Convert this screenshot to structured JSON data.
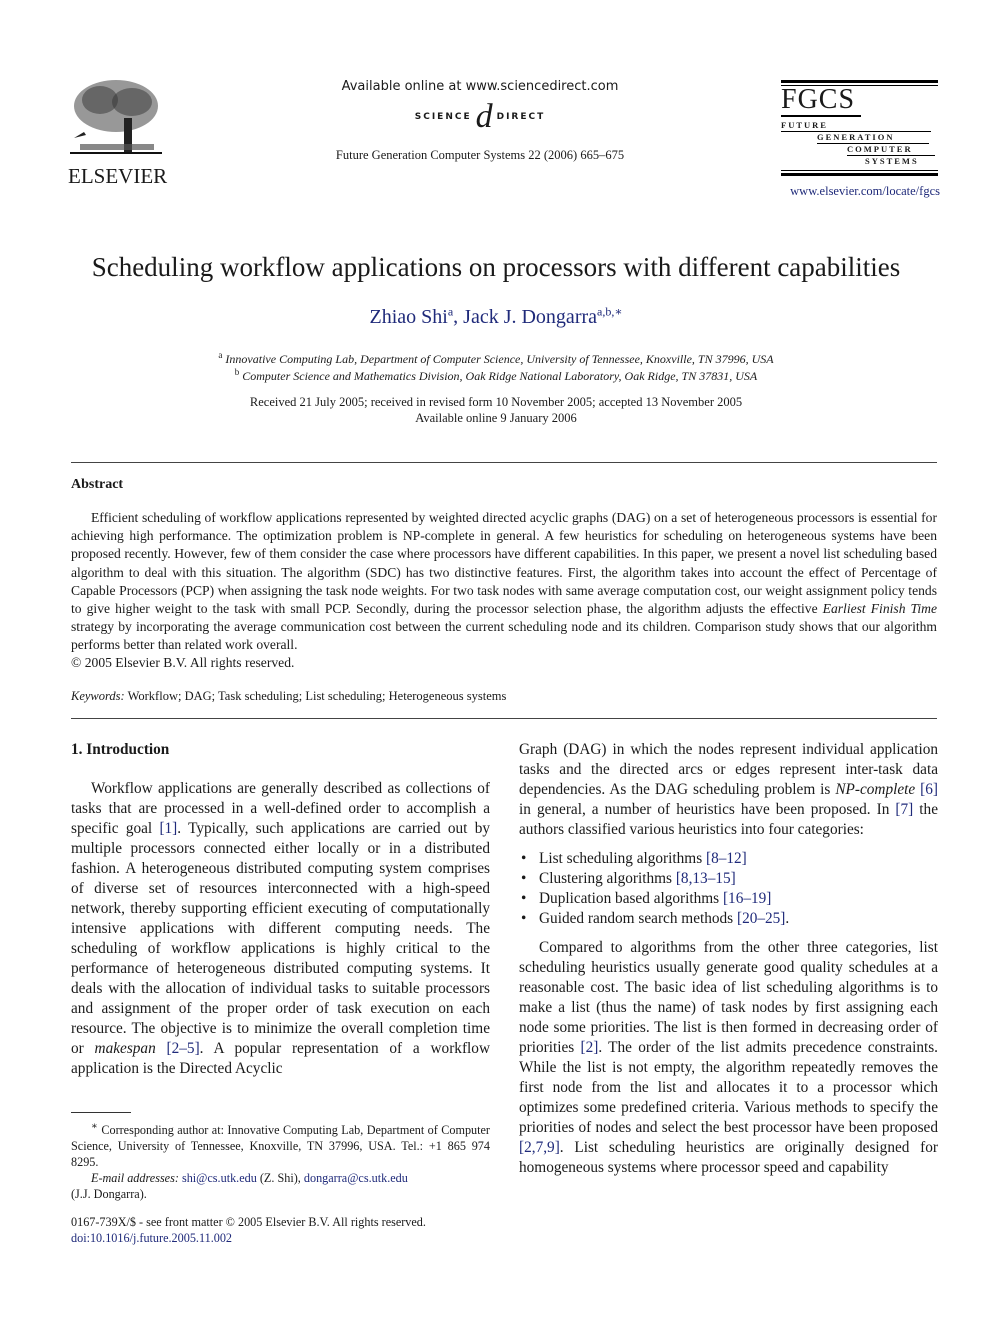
{
  "header": {
    "publisher_name": "ELSEVIER",
    "available_online": "Available online at www.sciencedirect.com",
    "sd_left": "SCIENCE",
    "sd_at": "d",
    "sd_right": "DIRECT",
    "journal_citation": "Future Generation Computer Systems 22 (2006) 665–675",
    "fgcs": {
      "title": "FGCS",
      "lines": [
        "FUTURE",
        "GENERATION",
        "COMPUTER",
        "SYSTEMS"
      ]
    },
    "journal_url": "www.elsevier.com/locate/fgcs"
  },
  "paper": {
    "title": "Scheduling workflow applications on processors with different capabilities",
    "authors": [
      {
        "name": "Zhiao Shi",
        "sup": "a"
      },
      {
        "name": "Jack J. Dongarra",
        "sup": "a,b,∗"
      }
    ],
    "author_separator": ", ",
    "affiliations": [
      {
        "sup": "a",
        "text": "Innovative Computing Lab, Department of Computer Science, University of Tennessee, Knoxville, TN 37996, USA"
      },
      {
        "sup": "b",
        "text": "Computer Science and Mathematics Division, Oak Ridge National Laboratory, Oak Ridge, TN 37831, USA"
      }
    ],
    "received": "Received 21 July 2005; received in revised form 10 November 2005; accepted 13 November 2005",
    "available": "Available online 9 January 2006"
  },
  "abstract": {
    "heading": "Abstract",
    "text_a": "Efficient scheduling of workflow applications represented by weighted directed acyclic graphs (DAG) on a set of heterogeneous processors is essential for achieving high performance. The optimization problem is NP-complete in general. A few heuristics for scheduling on heterogeneous systems have been proposed recently. However, few of them consider the case where processors have different capabilities. In this paper, we present a novel list scheduling based algorithm to deal with this situation. The algorithm (SDC) has two distinctive features. First, the algorithm takes into account the effect of Percentage of Capable Processors (PCP) when assigning the task node weights. For two task nodes with same average computation cost, our weight assignment policy tends to give higher weight to the task with small PCP. Secondly, during the processor selection phase, the algorithm adjusts the effective ",
    "text_italic": "Earliest Finish Time",
    "text_b": " strategy by incorporating the average communication cost between the current scheduling node and its children. Comparison study shows that our algorithm performs better than related work overall.",
    "copyright": "© 2005 Elsevier B.V. All rights reserved.",
    "keywords_label": "Keywords:",
    "keywords": " Workflow; DAG; Task scheduling; List scheduling; Heterogeneous systems"
  },
  "intro": {
    "heading": "1.  Introduction",
    "p1_a": "Workflow applications are generally described as collections of tasks that are processed in a well-defined order to accomplish a specific goal ",
    "p1_ref1": "[1]",
    "p1_b": ". Typically, such applications are carried out by multiple processors connected either locally or in a distributed fashion. A heterogeneous distributed computing system comprises of diverse set of resources interconnected with a high-speed network, thereby supporting efficient executing of computationally intensive applications with different computing needs. The scheduling of workflow applications is highly critical to the performance of heterogeneous distributed computing systems. It deals with the allocation of individual tasks to suitable processors and assignment of the proper order of task execution on each resource. The objective is to minimize the overall completion time or ",
    "p1_italic": "makespan",
    "p1_ref2": "[2–5]",
    "p1_c": ". A popular representation of a workflow application is the Directed Acyclic",
    "p2_a": "Graph (DAG) in which the nodes represent individual application tasks and the directed arcs or edges represent inter-task data dependencies. As the DAG scheduling problem is ",
    "p2_italic": "NP-complete",
    "p2_ref1": "[6]",
    "p2_b": " in general, a number of heuristics have been proposed. In ",
    "p2_ref2": "[7]",
    "p2_c": " the authors classified various heuristics into four categories:",
    "bullets": [
      {
        "text": "List scheduling algorithms ",
        "ref": "[8–12]",
        "tail": ""
      },
      {
        "text": "Clustering algorithms ",
        "ref": "[8,13–15]",
        "tail": ""
      },
      {
        "text": "Duplication based algorithms ",
        "ref": "[16–19]",
        "tail": ""
      },
      {
        "text": "Guided random search methods ",
        "ref": "[20–25]",
        "tail": "."
      }
    ],
    "p3_a": "Compared to algorithms from the other three categories, list scheduling heuristics usually generate good quality schedules at a reasonable cost. The basic idea of list scheduling algorithms is to make a list (thus the name) of task nodes by first assigning each node some priorities. The list is then formed in decreasing order of priorities ",
    "p3_ref1": "[2]",
    "p3_b": ". The order of the list admits precedence constraints. While the list is not empty, the algorithm repeatedly removes the first node from the list and allocates it to a processor which optimizes some predefined criteria. Various methods to specify the priorities of nodes and select the best processor have been proposed ",
    "p3_ref2": "[2,7,9]",
    "p3_c": ". List scheduling heuristics are originally designed for homogeneous systems where processor speed and capability"
  },
  "footnote": {
    "star": "∗",
    "corresponding": "Corresponding author at: Innovative Computing Lab, Department of Computer Science, University of Tennessee, Knoxville, TN 37996, USA. Tel.: +1 865 974 8295.",
    "email_label": "E-mail addresses:",
    "email1": "shi@cs.utk.edu",
    "email1_who": " (Z. Shi), ",
    "email2": "dongarra@cs.utk.edu",
    "email2_who": "(J.J. Dongarra).",
    "front_matter": "0167-739X/$ - see front matter © 2005 Elsevier B.V. All rights reserved.",
    "doi": "doi:10.1016/j.future.2005.11.002"
  }
}
